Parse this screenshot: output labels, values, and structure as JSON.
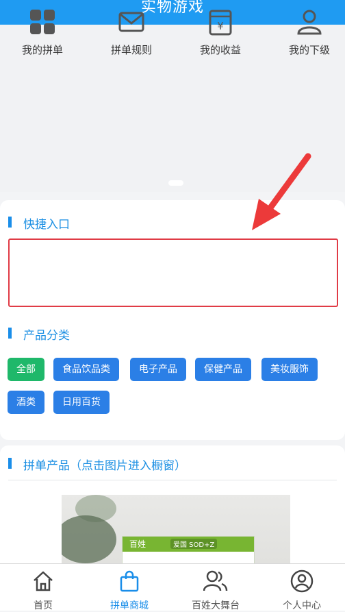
{
  "header": {
    "title": "实物游戏"
  },
  "quick_entry": {
    "title": "快捷入口",
    "items": [
      {
        "label": "我的拼单",
        "icon": "grid-icon"
      },
      {
        "label": "拼单规则",
        "icon": "mail-icon"
      },
      {
        "label": "我的收益",
        "icon": "yen-wallet-icon"
      },
      {
        "label": "我的下级",
        "icon": "user-icon"
      }
    ]
  },
  "categories": {
    "title": "产品分类",
    "items": [
      "全部",
      "食品饮品类",
      "电子产品",
      "保健产品",
      "美妆服饰",
      "酒类",
      "日用百货"
    ],
    "active": "全部"
  },
  "products": {
    "title": "拼单产品（点击图片进入橱窗）",
    "image_text": {
      "brand": "百姓",
      "tag": "爱国 SOD+Z"
    }
  },
  "tabbar": {
    "items": [
      {
        "label": "首页",
        "icon": "home-icon"
      },
      {
        "label": "拼单商城",
        "icon": "shopping-bag-icon"
      },
      {
        "label": "百姓大舞台",
        "icon": "users-icon"
      },
      {
        "label": "个人中心",
        "icon": "profile-icon"
      }
    ],
    "active": "拼单商城"
  },
  "colors": {
    "header_bg": "#1f9bf2",
    "accent": "#1a8ee9",
    "chip": "#2b7fe6",
    "chip_active": "#1fb86a",
    "highlight": "#e03b46"
  }
}
